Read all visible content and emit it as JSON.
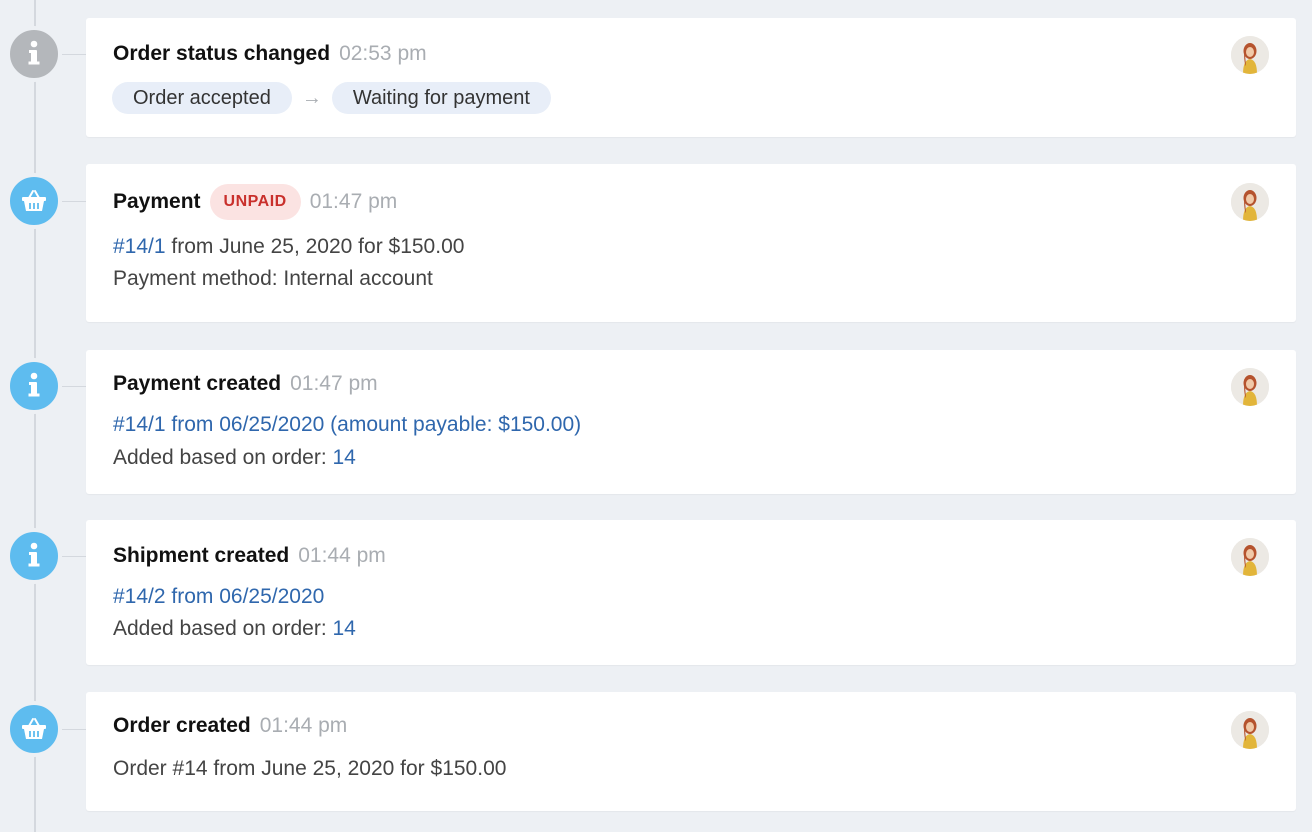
{
  "timeline": {
    "entries": [
      {
        "icon": "info-icon",
        "title": "Order status changed",
        "time": "02:53 pm",
        "status_from": "Order accepted",
        "status_to": "Waiting for payment",
        "arrow": "→"
      },
      {
        "icon": "basket-icon",
        "title": "Payment",
        "badge": "UNPAID",
        "time": "01:47 pm",
        "doc_link": "#14/1",
        "doc_text": " from June 25, 2020 for $150.00",
        "method_text": "Payment method: Internal account"
      },
      {
        "icon": "info-icon",
        "title": "Payment created",
        "time": "01:47 pm",
        "doc_link": "#14/1 from 06/25/2020 (amount payable: $150.00)",
        "based_label": "Added based on order: ",
        "based_link": "14"
      },
      {
        "icon": "info-icon",
        "title": "Shipment created",
        "time": "01:44 pm",
        "doc_link": "#14/2 from 06/25/2020",
        "based_label": "Added based on order: ",
        "based_link": "14"
      },
      {
        "icon": "basket-icon",
        "title": "Order created",
        "time": "01:44 pm",
        "summary": "Order #14 from June 25, 2020 for $150.00"
      }
    ]
  },
  "colors": {
    "background": "#edf0f4",
    "marker_gray": "#b4b7bb",
    "marker_blue": "#5ebcef",
    "link": "#2f67ad",
    "badge_bg": "#fbe3e2",
    "badge_text": "#c9302c",
    "chip_bg": "#e8eef8"
  }
}
